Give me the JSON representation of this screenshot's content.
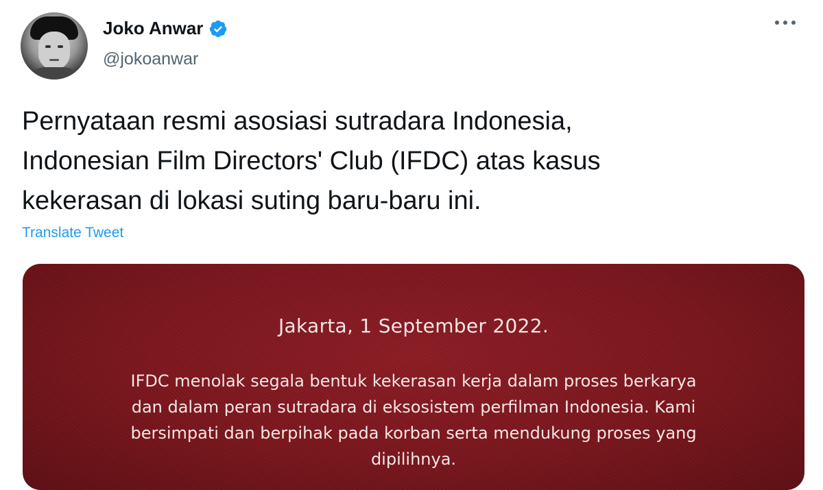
{
  "user": {
    "display_name": "Joko Anwar",
    "handle": "@jokoanwar",
    "verified": true
  },
  "tweet": {
    "text_lines": [
      "Pernyataan resmi asosiasi sutradara Indonesia,",
      "Indonesian Film Directors' Club (IFDC) atas kasus",
      "kekerasan di lokasi suting baru-baru ini."
    ],
    "translate_label": "Translate Tweet"
  },
  "media": {
    "date_line": "Jakarta, 1 September 2022.",
    "body_lines": [
      "IFDC menolak segala bentuk kekerasan kerja dalam proses berkarya",
      "dan dalam peran sutradara di eksosistem perfilman Indonesia. Kami",
      "bersimpati dan berpihak pada korban serta mendukung proses yang",
      "dipilihnya."
    ],
    "background_color": "#7a161d"
  },
  "icons": {
    "verified": "verified-badge-icon",
    "more": "more-options-icon"
  },
  "colors": {
    "link": "#1d9bf0",
    "handle": "#536471",
    "text": "#0f1419"
  }
}
